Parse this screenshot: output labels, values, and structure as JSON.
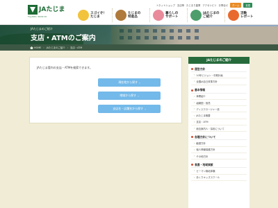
{
  "brand": {
    "name": "JAたじま",
    "sub": "TAJIMA NOKYO"
  },
  "utility": {
    "links": [
      "トネットショップ",
      "支店等",
      "たじまり農業",
      "アクセシビリ",
      "お問合せ"
    ],
    "buttons": [
      "ホーム",
      "言語"
    ]
  },
  "gnav": [
    {
      "label": "スゴイぞ！\nたじま",
      "icon": "smile-icon",
      "color": "#f2c33c"
    },
    {
      "label": "たじまの\n特産品",
      "icon": "cow-icon",
      "color": "#b07a3b"
    },
    {
      "label": "暮らしの\nサポート",
      "icon": "house-icon",
      "color": "#e98b9a"
    },
    {
      "label": "JAたじまの\nご紹介",
      "icon": "person-icon",
      "color": "#4d9e6b"
    },
    {
      "label": "活動\nレポート",
      "icon": "report-icon",
      "color": "#e96a2d"
    }
  ],
  "hero": {
    "sub": "JAたじまのご紹介",
    "title": "支店・ATMのご案内"
  },
  "breadcrumb": [
    "HOME",
    "JAたじまのご紹介",
    "支店・ATM"
  ],
  "main": {
    "intro": "JAたじま管内の支店・ATMを検索できます。",
    "buttons": [
      "現在地から探す",
      "地域から探す",
      "支店名・店舗名から探す"
    ]
  },
  "sidebar": {
    "title": "JAたじまのご紹介",
    "groups": [
      {
        "category": "運営方針",
        "links": [
          "10年ビジョン・中期計画",
          "全国JA自己改革方針"
        ]
      },
      {
        "category": "基本情報",
        "links": [
          "事業紹介",
          "組織図・役員",
          "ディスクロージャー誌",
          "JAたじま概要",
          "支店・ATM",
          "総合案内人・採用について"
        ]
      },
      {
        "category": "各種方針について",
        "links": [
          "勧誘方針",
          "個人情報保護方針",
          "その他方針"
        ]
      },
      {
        "category": "食農・地域貢献",
        "links": [
          "ビーマン栽培体験",
          "あくりキッズスクール"
        ]
      }
    ]
  },
  "colors": {
    "brand_green": "#1d6b35",
    "nav_dark": "#276b3c",
    "button_blue": "#73b9e9",
    "background": "#f1ecd6"
  }
}
